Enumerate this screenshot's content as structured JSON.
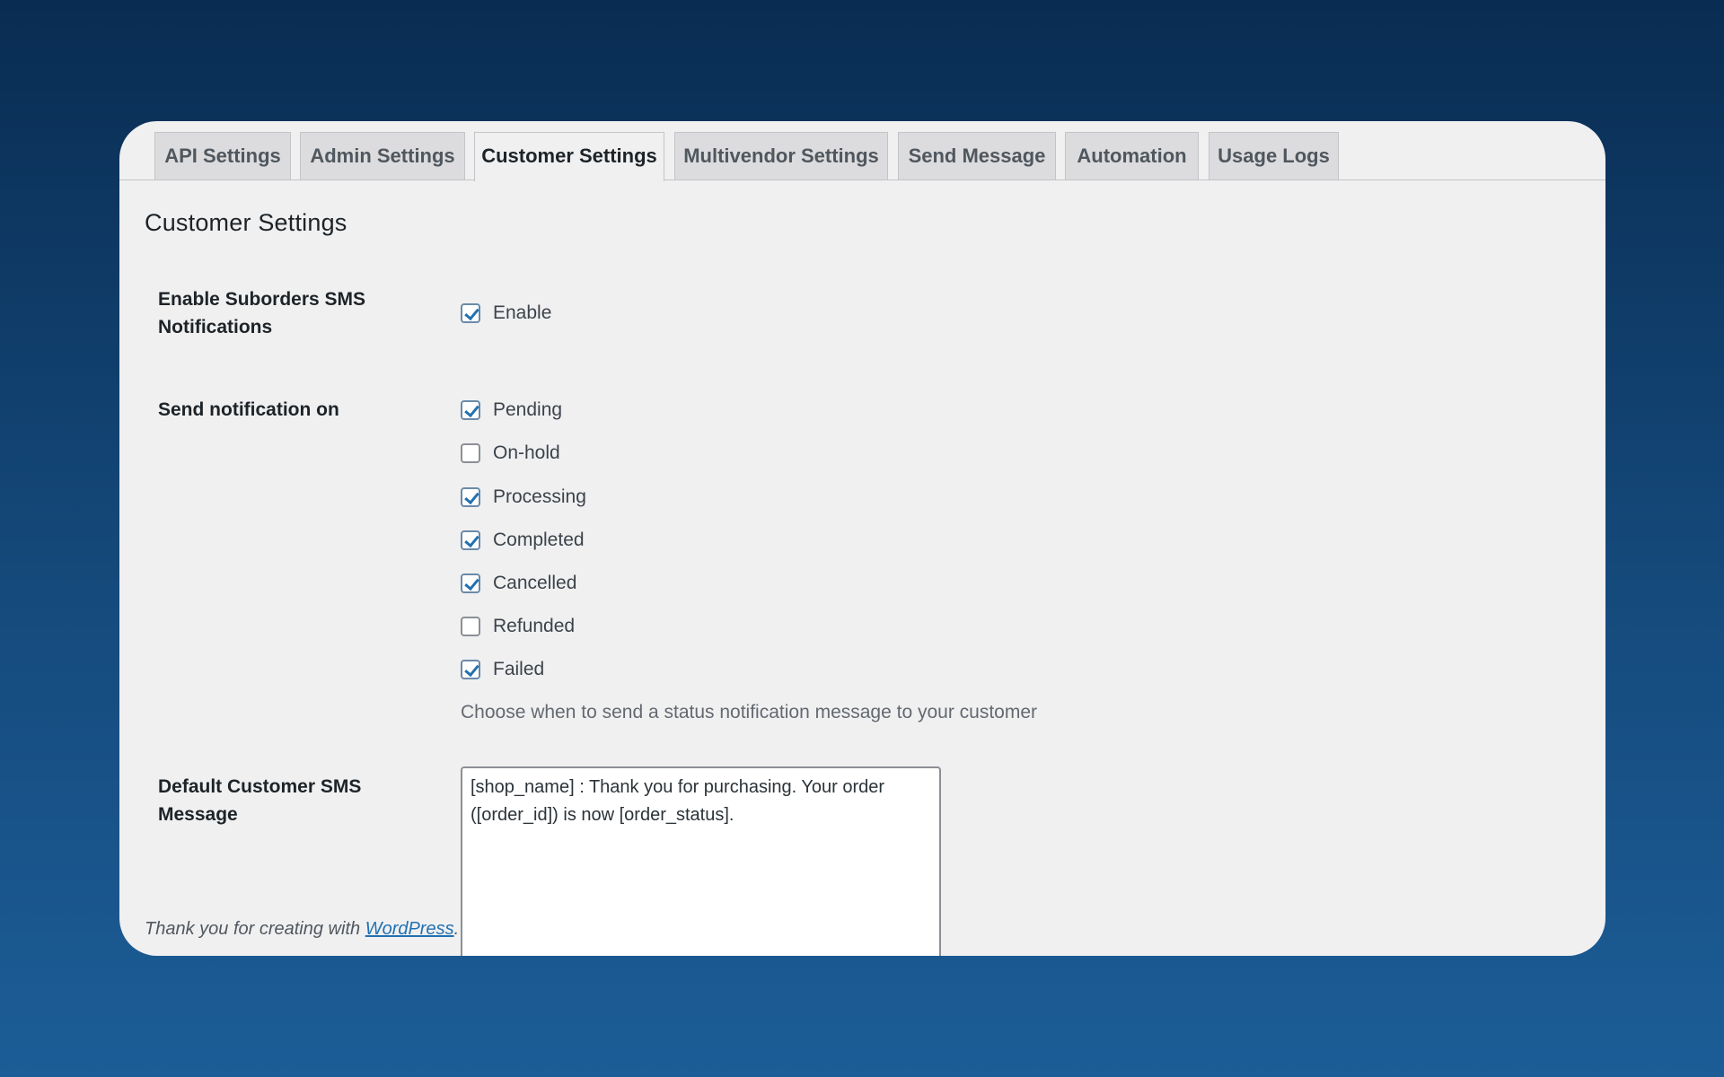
{
  "tabs": [
    {
      "label": "API Settings",
      "active": false
    },
    {
      "label": "Admin Settings",
      "active": false
    },
    {
      "label": "Customer Settings",
      "active": true
    },
    {
      "label": "Multivendor Settings",
      "active": false
    },
    {
      "label": "Send Message",
      "active": false
    },
    {
      "label": "Automation",
      "active": false
    },
    {
      "label": "Usage Logs",
      "active": false
    }
  ],
  "page_title": "Customer Settings",
  "suborders": {
    "label": "Enable Suborders SMS Notifications",
    "option": {
      "label": "Enable",
      "checked": true
    }
  },
  "notify": {
    "label": "Send notification on",
    "options": [
      {
        "label": "Pending",
        "checked": true
      },
      {
        "label": "On-hold",
        "checked": false
      },
      {
        "label": "Processing",
        "checked": true
      },
      {
        "label": "Completed",
        "checked": true
      },
      {
        "label": "Cancelled",
        "checked": true
      },
      {
        "label": "Refunded",
        "checked": false
      },
      {
        "label": "Failed",
        "checked": true
      }
    ],
    "description": "Choose when to send a status notification message to your customer"
  },
  "default_message": {
    "label": "Default Customer SMS Message",
    "value": "[shop_name] : Thank you for purchasing. Your order ([order_id]) is now [order_status]."
  },
  "footer": {
    "text": "Thank you for creating with ",
    "link": "WordPress",
    "suffix": "."
  },
  "colors": {
    "accent": "#2271b1",
    "panel_bg": "#f0f0f1",
    "tab_bg": "#dcdcde"
  }
}
